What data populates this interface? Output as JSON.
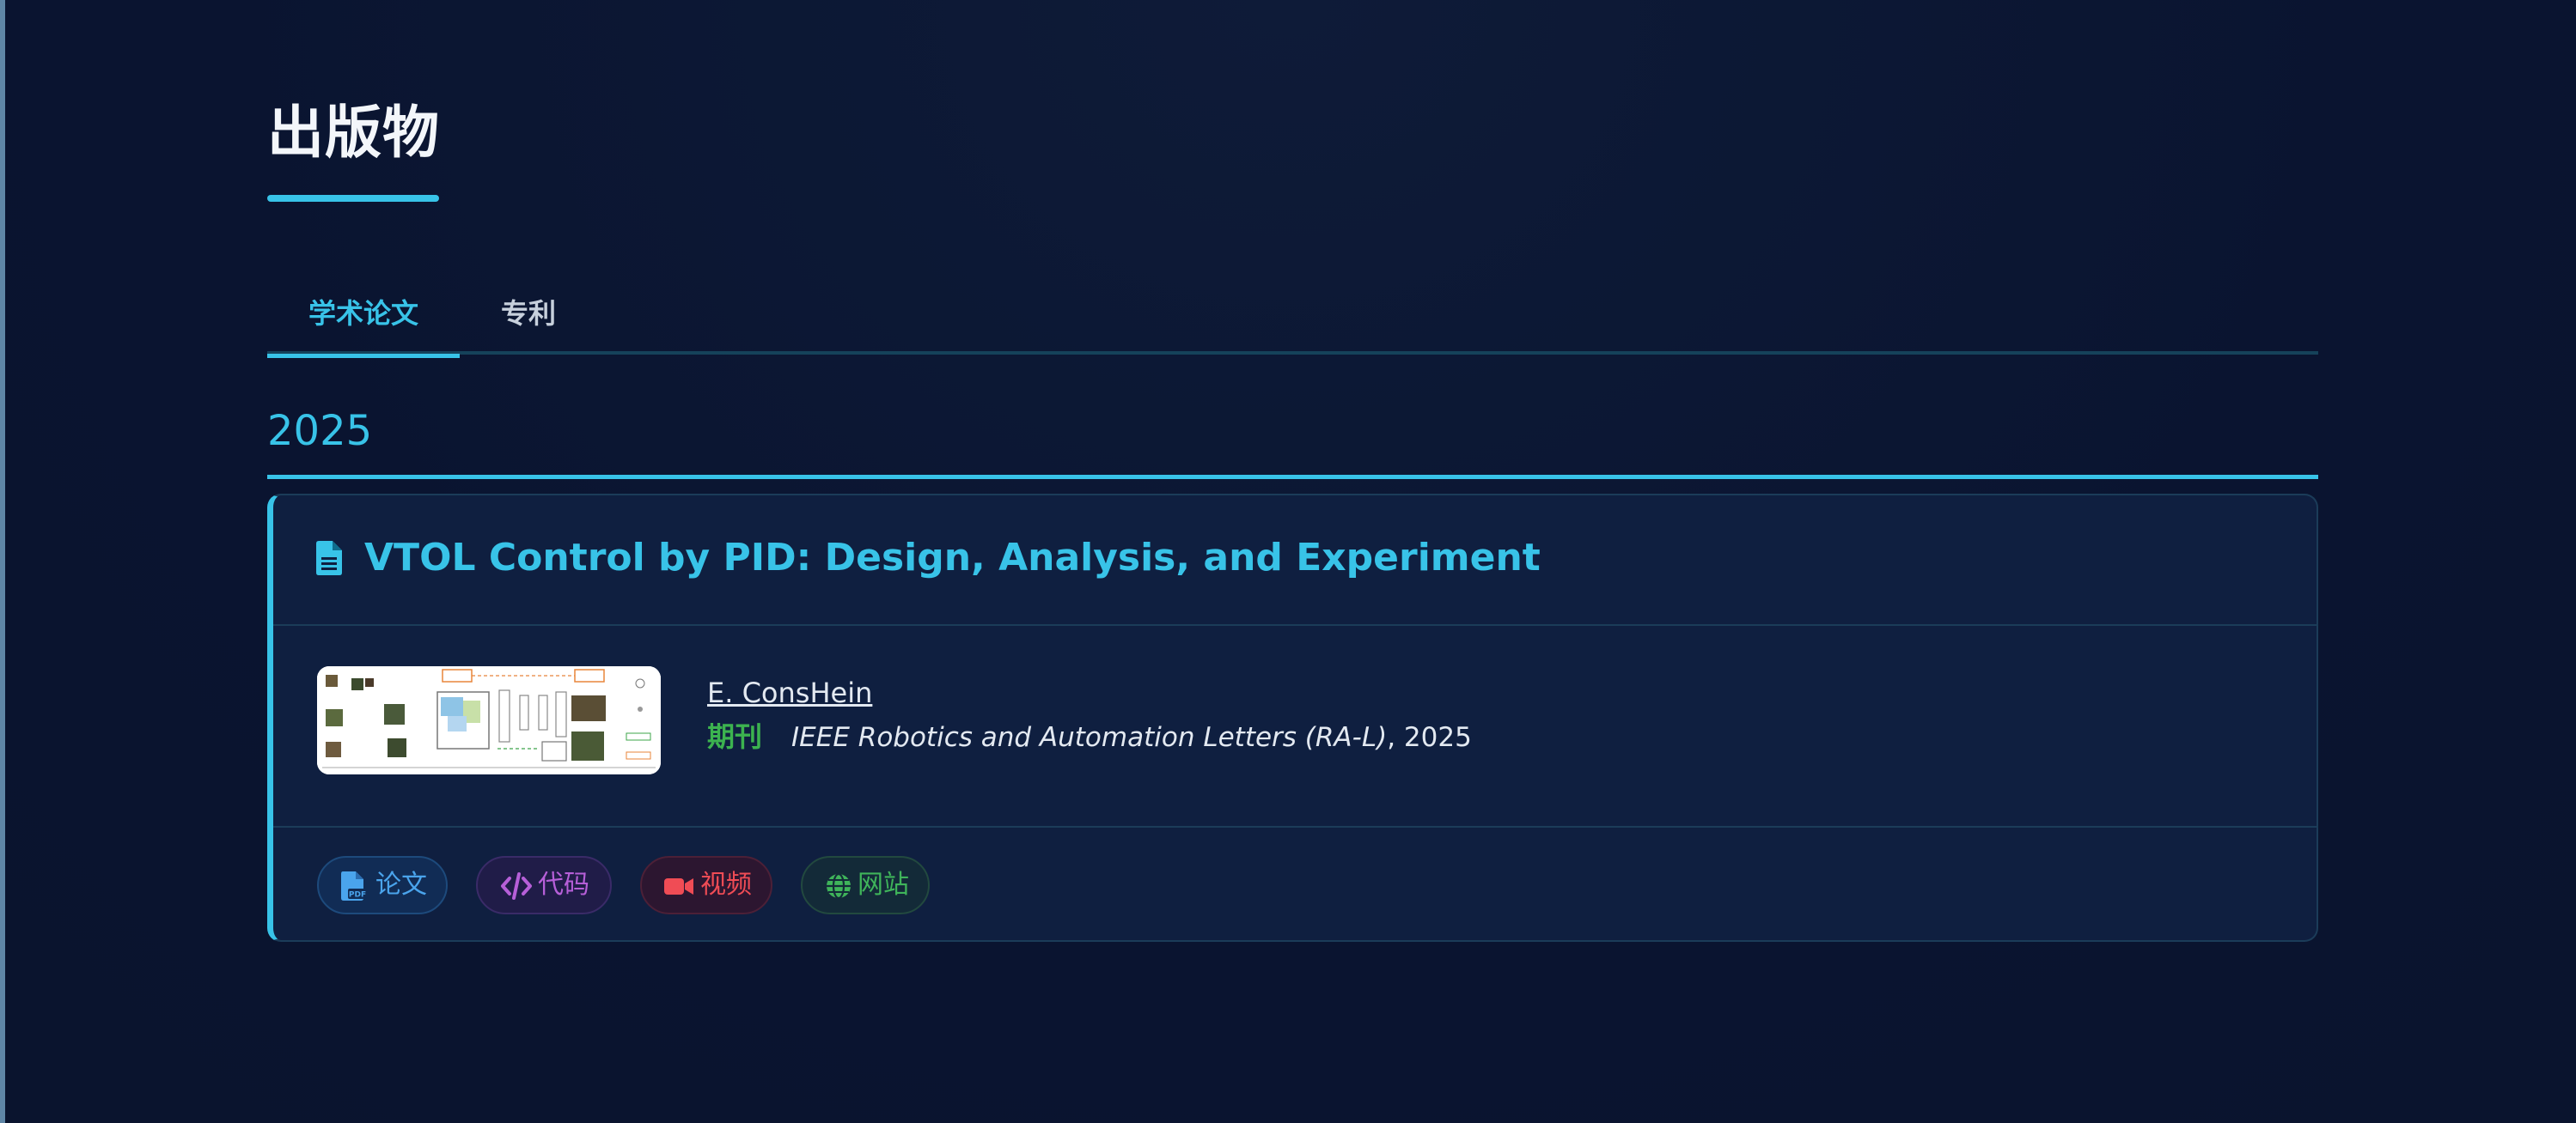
{
  "page": {
    "title": "出版物"
  },
  "tabs": [
    {
      "label": "学术论文",
      "active": true
    },
    {
      "label": "专利",
      "active": false
    }
  ],
  "sections": [
    {
      "year": "2025",
      "publications": [
        {
          "title": "VTOL Control by PID: Design, Analysis, and Experiment",
          "author": "E. ConsHein",
          "venue_type": "期刊",
          "venue": "IEEE Robotics and Automation Letters (RA-L)",
          "venue_year": ", 2025",
          "thumbnail": "method-framework-diagram",
          "links": [
            {
              "label": "论文",
              "icon": "file-pdf-icon",
              "color": "#4aa4ec"
            },
            {
              "label": "代码",
              "icon": "code-icon",
              "color": "#b65fd8"
            },
            {
              "label": "视频",
              "icon": "video-icon",
              "color": "#f04c55"
            },
            {
              "label": "网站",
              "icon": "globe-icon",
              "color": "#3fb45a"
            }
          ]
        }
      ]
    }
  ],
  "colors": {
    "accent": "#38c3e8",
    "background": "#0b1530",
    "card": "#0f1f40",
    "journal_tag": "#3cb34f"
  }
}
